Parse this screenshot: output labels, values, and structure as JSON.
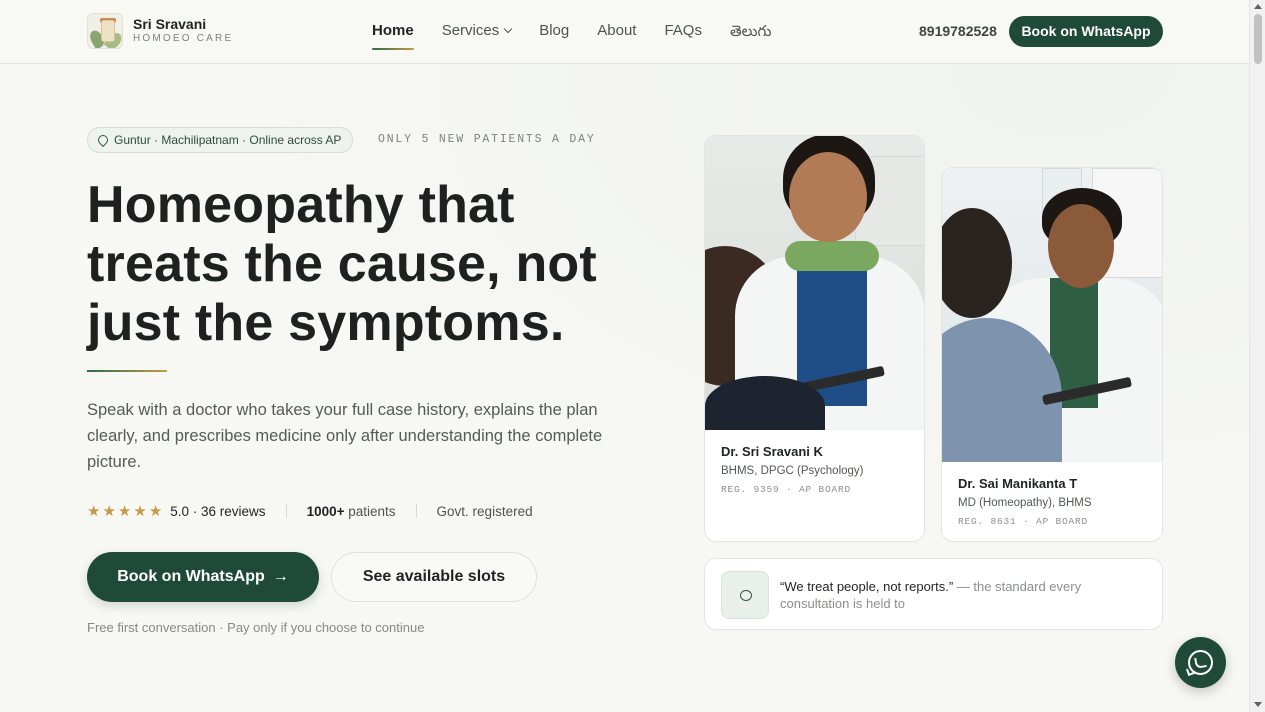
{
  "brand": {
    "name": "Sri Sravani",
    "tagline": "HOMOEO CARE",
    "logo_icon": "herbal-jar-icon"
  },
  "nav": {
    "items": [
      {
        "label": "Home",
        "active": true
      },
      {
        "label": "Services",
        "has_dropdown": true
      },
      {
        "label": "Blog"
      },
      {
        "label": "About"
      },
      {
        "label": "FAQs"
      },
      {
        "label": "తెలుగు"
      }
    ]
  },
  "header": {
    "phone": "8919782528",
    "cta_label": "Book on WhatsApp"
  },
  "hero": {
    "location_badge": "Guntur · Machilipatnam · Online across AP",
    "location_icon": "map-pin-icon",
    "capacity_note": "ONLY 5 NEW PATIENTS A DAY",
    "headline": "Homeopathy that treats the cause, not just the symptoms.",
    "lead": "Speak with a doctor who takes your full case history, explains the plan clearly, and prescribes medicine only after understanding the complete picture.",
    "rating": {
      "stars": 5,
      "max": 5,
      "text": "5.0 · 36 reviews"
    },
    "patients_count": "1000+",
    "patients_label": "patients",
    "registration": "Govt. registered",
    "primary_cta": "Book on WhatsApp",
    "primary_cta_arrow": "→",
    "secondary_cta": "See available slots",
    "fine_print": "Free first conversation · Pay only if you choose to continue"
  },
  "doctors": [
    {
      "name": "Dr. Sri Sravani K",
      "degrees": "BHMS, DPGC (Psychology)",
      "reg": "REG. 9359 · AP BOARD"
    },
    {
      "name": "Dr. Sai Manikanta T",
      "degrees": "MD (Homeopathy), BHMS",
      "reg": "REG. 8631 · AP BOARD"
    }
  ],
  "quote": {
    "icon": "chat-bubble-icon",
    "text_strong": "“We treat people, not reports.”",
    "text_rest": " — the standard every consultation is held to"
  },
  "fab": {
    "icon": "whatsapp-icon"
  },
  "colors": {
    "primary": "#1f4a37",
    "accent_gold": "#c59a49",
    "background": "#f7f7f3"
  }
}
